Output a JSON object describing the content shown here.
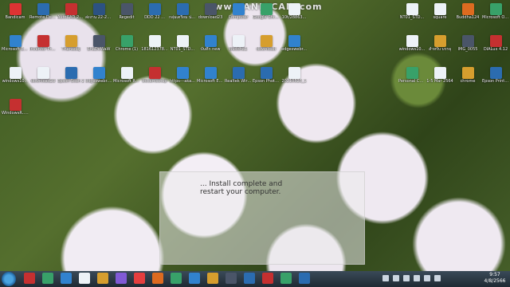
{
  "watermark": "www.BANDICAM.com",
  "dialog_text": "... Install complete and restart your computer.",
  "clock": {
    "time": "9:57",
    "date": "4/8/2566"
  },
  "desktop_icons": [
    {
      "label": "Bandicam",
      "color": "#d33"
    },
    {
      "label": "Remote Desktop...",
      "color": "#2b6cb0"
    },
    {
      "label": "AutoCAD 2013 - English",
      "color": "#c53030"
    },
    {
      "label": "ส่งงาน 22-25 ...",
      "color": "#2c5282"
    },
    {
      "label": "Regedit",
      "color": "#4a5568"
    },
    {
      "label": "DDD 22 ...",
      "color": "#2b6cb0"
    },
    {
      "label": "กลุ่มเตรียม น่าน",
      "color": "#2b6cb0"
    },
    {
      "label": "download23",
      "color": "#4a5568"
    },
    {
      "label": "Computer",
      "color": "#3182ce"
    },
    {
      "label": "Google Chrome",
      "color": "#38a169"
    },
    {
      "label": "10t/28863...",
      "color": "#edf2f7"
    },
    {
      "label": "NT01_STD...",
      "color": "#edf2f7"
    },
    {
      "label": "square",
      "color": "#edf2f7"
    },
    {
      "label": "Buddha124",
      "color": "#dd6b20"
    },
    {
      "label": "Microsoft Office Pr...",
      "color": "#38a169"
    },
    {
      "label": "Microsoft Edge",
      "color": "#3182ce"
    },
    {
      "label": "Inventor Professio...",
      "color": "#c53030"
    },
    {
      "label": "Thanadej",
      "color": "#d69e2e"
    },
    {
      "label": "ShaDeWaW",
      "color": "#4a5568"
    },
    {
      "label": "Chrome (1)",
      "color": "#38a169"
    },
    {
      "label": "181612378...",
      "color": "#edf2f7"
    },
    {
      "label": "NT01_STD...",
      "color": "#edf2f7"
    },
    {
      "label": "บันทึก new",
      "color": "#3182ce"
    },
    {
      "label": "Buddha1",
      "color": "#edf2f7"
    },
    {
      "label": "download",
      "color": "#d69e2e"
    },
    {
      "label": "edgeswebr...",
      "color": "#3182ce"
    },
    {
      "label": "windows10...",
      "color": "#edf2f7"
    },
    {
      "label": "สำหรับ บรรจุ",
      "color": "#d69e2e"
    },
    {
      "label": "IMG_0055",
      "color": "#4a5568"
    },
    {
      "label": "DIALux 4.12",
      "color": "#c53030"
    },
    {
      "label": "windows10...",
      "color": "#edf2f7"
    },
    {
      "label": "download23",
      "color": "#edf2f7"
    },
    {
      "label": "Epson Scan 2",
      "color": "#2b6cb0"
    },
    {
      "label": "edgeswebr... (2)",
      "color": "#3182ce"
    },
    {
      "label": "Microsoft Root Certifi...",
      "color": "#edf2f7"
    },
    {
      "label": "bdcamsetup",
      "color": "#c53030"
    },
    {
      "label": "https---aka...",
      "color": "#3182ce"
    },
    {
      "label": "Microsoft Edge (2)",
      "color": "#3182ce"
    },
    {
      "label": "Realtek Wireless LAN",
      "color": "#2b6cb0"
    },
    {
      "label": "Epson Photo+",
      "color": "#2b6cb0"
    },
    {
      "label": "20210525_1",
      "color": "#edf2f7"
    },
    {
      "label": "Personal Channel",
      "color": "#38a169"
    },
    {
      "label": "1-5 Mar 2564",
      "color": "#edf2f7"
    },
    {
      "label": "chrome",
      "color": "#d69e2e"
    },
    {
      "label": "Epson Printer Connecti...",
      "color": "#2b6cb0"
    },
    {
      "label": "WindowsR... 13.64",
      "color": "#c53030"
    }
  ],
  "taskbar_apps": [
    "#c53030",
    "#38a169",
    "#3182ce",
    "#edf2f7",
    "#d69e2e",
    "#805ad5",
    "#e53e3e",
    "#dd6b20",
    "#38a169",
    "#3182ce",
    "#d69e2e",
    "#4a5568",
    "#2b6cb0",
    "#c53030",
    "#38a169",
    "#2b6cb0"
  ]
}
